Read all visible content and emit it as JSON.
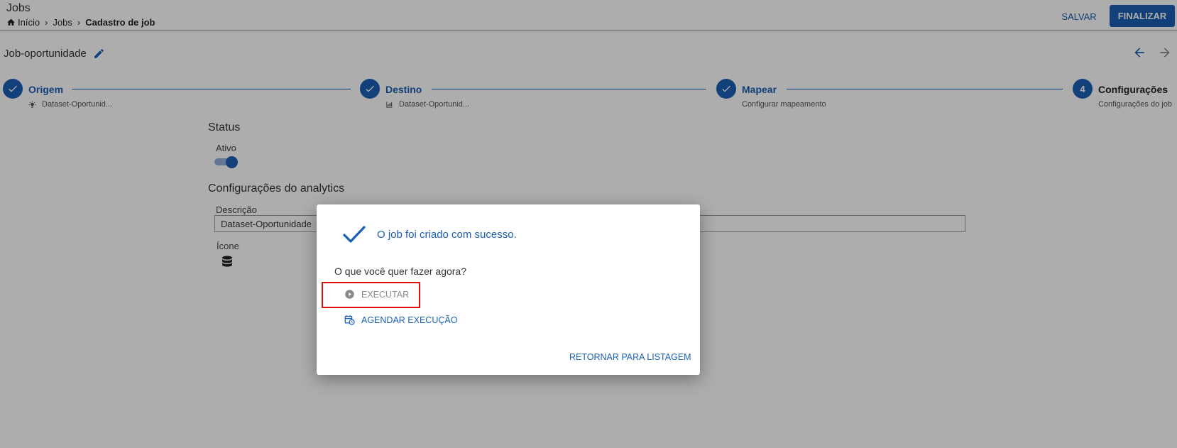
{
  "header": {
    "title": "Jobs",
    "breadcrumb": [
      "Início",
      "Jobs",
      "Cadastro de job"
    ],
    "save_label": "SALVAR",
    "finish_label": "FINALIZAR"
  },
  "job": {
    "name": "Job-oportunidade"
  },
  "stepper": {
    "steps": [
      {
        "number": "",
        "label": "Origem",
        "sub": "Dataset-Oportunid...",
        "icon": "lightbulb-icon",
        "status": "done"
      },
      {
        "number": "",
        "label": "Destino",
        "sub": "Dataset-Oportunid...",
        "icon": "chart-icon",
        "status": "done"
      },
      {
        "number": "",
        "label": "Mapear",
        "sub": "Configurar mapeamento",
        "icon": "",
        "status": "done"
      },
      {
        "number": "4",
        "label": "Configurações",
        "sub": "Configurações do job",
        "icon": "",
        "status": "active"
      }
    ]
  },
  "form": {
    "status_title": "Status",
    "active_label": "Ativo",
    "active": true,
    "analytics_title": "Configurações do analytics",
    "description_label": "Descrição",
    "description_value": "Dataset-Oportunidade",
    "icon_label": "Ícone",
    "icon": "database-icon"
  },
  "dialog": {
    "message": "O job foi criado com sucesso.",
    "question": "O que você quer fazer agora?",
    "execute_label": "EXECUTAR",
    "schedule_label": "AGENDAR EXECUÇÃO",
    "return_label": "RETORNAR PARA LISTAGEM"
  },
  "colors": {
    "primary": "#1a5fb4",
    "highlight": "#e11010",
    "disabled": "#8a8a8a"
  }
}
